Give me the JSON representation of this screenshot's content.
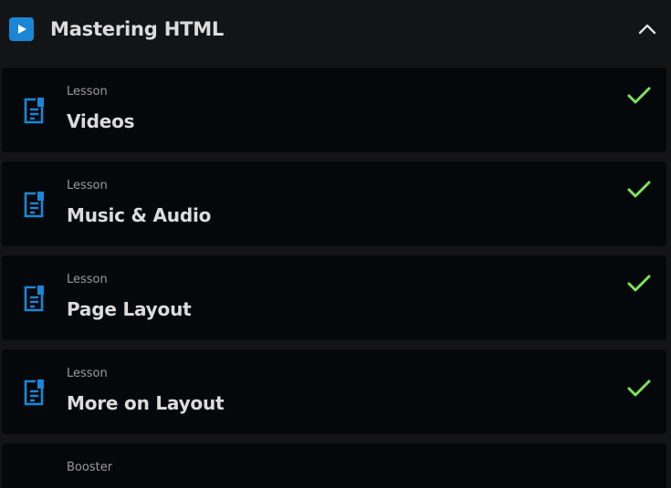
{
  "module": {
    "title": "Mastering HTML",
    "badge_icon": "play-icon",
    "collapse_icon": "chevron-up-icon"
  },
  "items": [
    {
      "kind": "Lesson",
      "title": "Videos",
      "icon": "document-icon",
      "completed": true
    },
    {
      "kind": "Lesson",
      "title": "Music & Audio",
      "icon": "document-icon",
      "completed": true
    },
    {
      "kind": "Lesson",
      "title": "Page Layout",
      "icon": "document-icon",
      "completed": true
    },
    {
      "kind": "Lesson",
      "title": "More on Layout",
      "icon": "document-icon",
      "completed": true
    },
    {
      "kind": "Booster"
    }
  ],
  "colors": {
    "background": "#131416",
    "card": "#05080a",
    "accent": "#1a86d8",
    "check": "#7ee35a",
    "title_text": "#dcdcdc",
    "muted_text": "#9a9a9a"
  }
}
